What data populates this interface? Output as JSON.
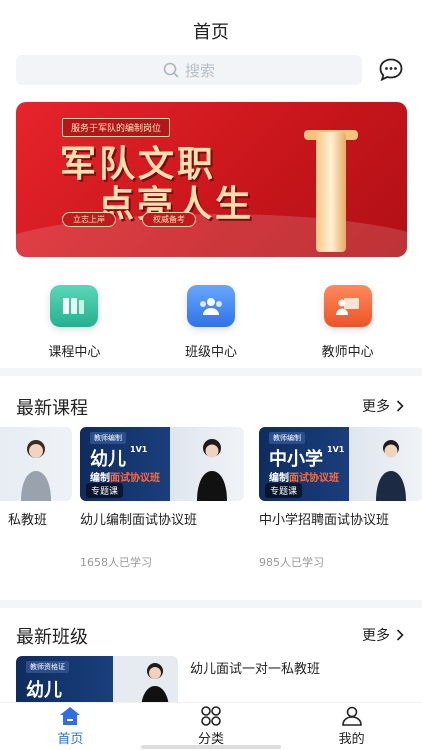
{
  "header": {
    "title": "首页"
  },
  "search": {
    "placeholder": "搜索",
    "icon": "search-icon"
  },
  "header_actions": {
    "message_icon": "chat-bubble-icon"
  },
  "banner": {
    "tag": "服务于军队的编制岗位",
    "line1": "军队文职",
    "line2": "点亮人生",
    "pill1": "立志上岸",
    "pill2": "权威备考",
    "slide_count": 4,
    "active_slide": 3
  },
  "shortcuts": [
    {
      "label": "课程中心",
      "icon": "books-icon",
      "color": "#34c3a0"
    },
    {
      "label": "班级中心",
      "icon": "group-icon",
      "color": "#3f86f0"
    },
    {
      "label": "教师中心",
      "icon": "teacher-icon",
      "color": "#f26b3a"
    }
  ],
  "latest_courses": {
    "title": "最新课程",
    "more": "更多",
    "items": [
      {
        "name": "私教班",
        "thumb_title": "",
        "thumb_sub": "",
        "count": ""
      },
      {
        "name": "幼儿编制面试协议班",
        "badge": "教师编制",
        "thumb_title": "幼儿",
        "thumb_tag": "1V1",
        "thumb_sub_prefix": "编制",
        "thumb_sub_accent": "面试协议班",
        "label": "专题课",
        "count": "1658人已学习"
      },
      {
        "name": "中小学招聘面试协议班",
        "badge": "教师编制",
        "thumb_title": "中小学",
        "thumb_tag": "1V1",
        "thumb_sub_prefix": "编制",
        "thumb_sub_accent": "面试协议班",
        "label": "专题课",
        "count": "985人已学习"
      }
    ]
  },
  "latest_classes": {
    "title": "最新班级",
    "more": "更多",
    "items": [
      {
        "name": "幼儿面试一对一私教班",
        "badge": "教师资格证",
        "thumb_title": "幼儿"
      }
    ]
  },
  "tabbar": [
    {
      "label": "首页",
      "icon": "home-icon",
      "active": true
    },
    {
      "label": "分类",
      "icon": "category-icon",
      "active": false
    },
    {
      "label": "我的",
      "icon": "user-icon",
      "active": false
    }
  ],
  "colors": {
    "accent": "#2f6fe4",
    "banner_red": "#d81e24",
    "course_navy": "#0f2c5e"
  }
}
